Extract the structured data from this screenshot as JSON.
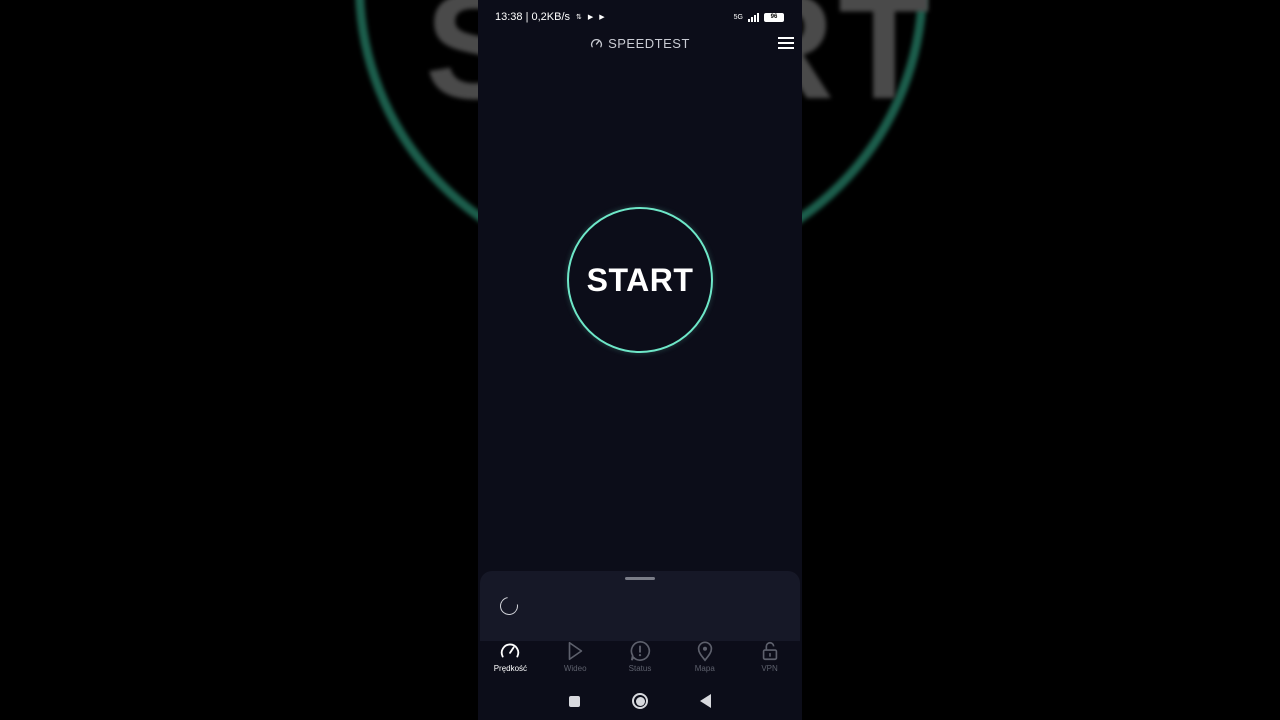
{
  "background": {
    "text": "START"
  },
  "status_bar": {
    "time_speed": "13:38 | 0,2KB/s",
    "network": "5G",
    "battery": "96"
  },
  "app_bar": {
    "title": "SPEEDTEST"
  },
  "main": {
    "start_label": "START"
  },
  "tabs": [
    {
      "label": "Prędkość",
      "icon": "speedometer-icon",
      "active": true
    },
    {
      "label": "Wideo",
      "icon": "play-icon",
      "active": false
    },
    {
      "label": "Status",
      "icon": "alert-icon",
      "active": false
    },
    {
      "label": "Mapa",
      "icon": "map-pin-icon",
      "active": false
    },
    {
      "label": "VPN",
      "icon": "lock-icon",
      "active": false
    }
  ],
  "colors": {
    "accent": "#6ee7c8",
    "background": "#0c0d19",
    "sheet": "#161827",
    "inactive_tab": "#5d606c"
  }
}
